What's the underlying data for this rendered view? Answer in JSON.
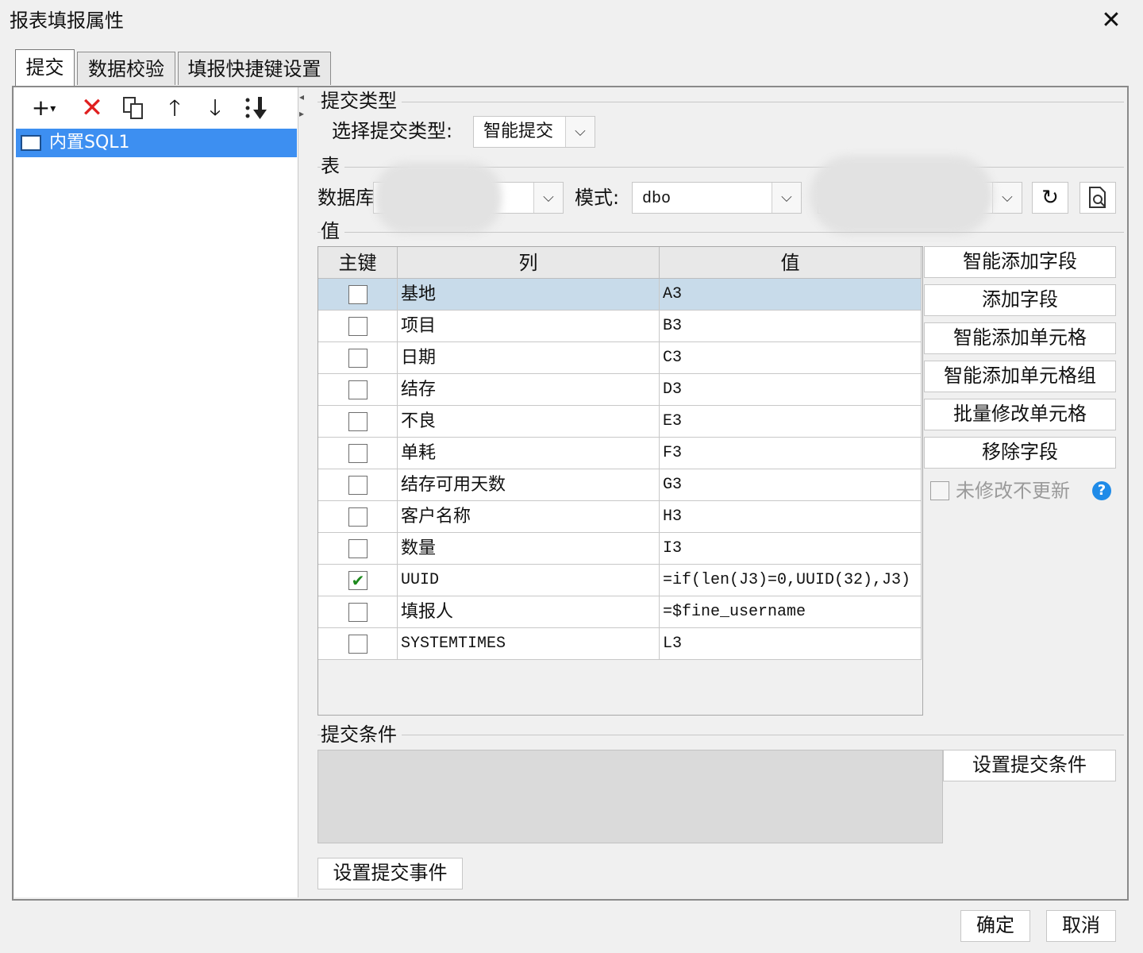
{
  "window": {
    "title": "报表填报属性"
  },
  "tabs": [
    {
      "label": "提交"
    },
    {
      "label": "数据校验"
    },
    {
      "label": "填报快捷键设置"
    }
  ],
  "tree": {
    "items": [
      {
        "label": "内置SQL1"
      }
    ]
  },
  "submit_type": {
    "section": "提交类型",
    "label": "选择提交类型:",
    "value": "智能提交"
  },
  "table_section": {
    "section": "表",
    "database_label": "数据库",
    "mode_label": "模式:",
    "mode_value": "dbo"
  },
  "value_section": {
    "section": "值",
    "headers": {
      "key": "主键",
      "column": "列",
      "value": "值"
    },
    "rows": [
      {
        "column": "基地",
        "value": "A3",
        "key": false
      },
      {
        "column": "项目",
        "value": "B3",
        "key": false
      },
      {
        "column": "日期",
        "value": "C3",
        "key": false
      },
      {
        "column": "结存",
        "value": "D3",
        "key": false
      },
      {
        "column": "不良",
        "value": "E3",
        "key": false
      },
      {
        "column": "单耗",
        "value": "F3",
        "key": false
      },
      {
        "column": "结存可用天数",
        "value": "G3",
        "key": false
      },
      {
        "column": "客户名称",
        "value": "H3",
        "key": false
      },
      {
        "column": "数量",
        "value": "I3",
        "key": false
      },
      {
        "column": "UUID",
        "value": "=if(len(J3)=0,UUID(32),J3)",
        "key": true
      },
      {
        "column": "填报人",
        "value": "=$fine_username",
        "key": false
      },
      {
        "column": "SYSTEMTIMES",
        "value": "L3",
        "key": false
      }
    ]
  },
  "side_buttons": {
    "smart_add_field": "智能添加字段",
    "add_field": "添加字段",
    "smart_add_cell": "智能添加单元格",
    "smart_add_cell_group": "智能添加单元格组",
    "batch_modify_cell": "批量修改单元格",
    "remove_field": "移除字段",
    "no_update_unmodified": "未修改不更新"
  },
  "condition": {
    "section": "提交条件",
    "set_button": "设置提交条件"
  },
  "event_button": "设置提交事件",
  "footer": {
    "ok": "确定",
    "cancel": "取消"
  },
  "colors": {
    "accent": "#3d8ff1",
    "delete": "#e02020",
    "check": "#1e8a1e",
    "help": "#1f8be8"
  }
}
